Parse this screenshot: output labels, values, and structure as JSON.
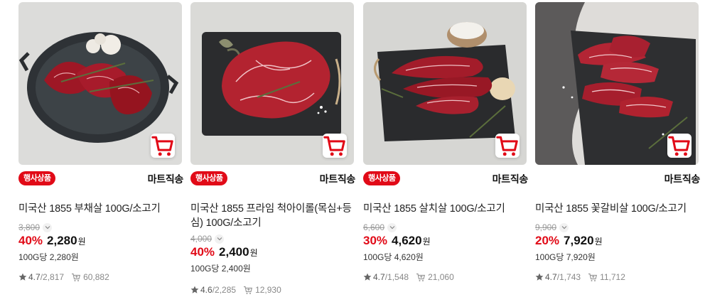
{
  "colors": {
    "accent": "#e10a17"
  },
  "products": [
    {
      "title": "미국산 1855 부채살 100G/소고기",
      "badge": "행사상품",
      "delivery": "마트직송",
      "original_price": "3,800",
      "discount": "40%",
      "price": "2,280",
      "won": "원",
      "unit_price": "100G당 2,280원",
      "rating": "4.7",
      "reviews": "/2,817",
      "cart_count": "60,882"
    },
    {
      "title": "미국산 1855 프라임 척아이롤(목심+등심) 100G/소고기",
      "badge": "행사상품",
      "delivery": "마트직송",
      "original_price": "4,000",
      "discount": "40%",
      "price": "2,400",
      "won": "원",
      "unit_price": "100G당 2,400원",
      "rating": "4.6",
      "reviews": "/2,285",
      "cart_count": "12,930"
    },
    {
      "title": "미국산 1855 살치살 100G/소고기",
      "badge": "행사상품",
      "delivery": "마트직송",
      "original_price": "6,600",
      "discount": "30%",
      "price": "4,620",
      "won": "원",
      "unit_price": "100G당 4,620원",
      "rating": "4.7",
      "reviews": "/1,548",
      "cart_count": "21,060"
    },
    {
      "title": "미국산 1855 꽃갈비살 100G/소고기",
      "badge": "",
      "delivery": "마트직송",
      "original_price": "9,900",
      "discount": "20%",
      "price": "7,920",
      "won": "원",
      "unit_price": "100G당 7,920원",
      "rating": "4.7",
      "reviews": "/1,743",
      "cart_count": "11,712"
    }
  ]
}
